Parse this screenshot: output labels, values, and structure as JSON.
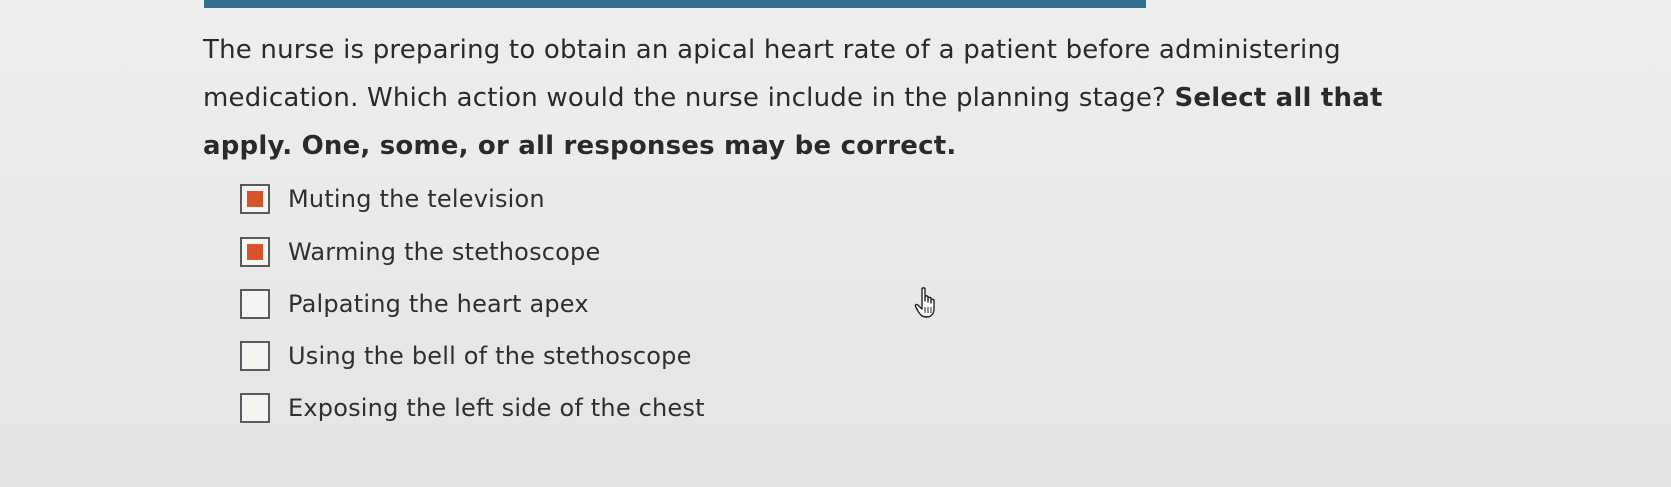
{
  "question": {
    "text": "The nurse is preparing to obtain an apical heart rate of a patient before administering medication. Which action would the nurse include in the planning stage? ",
    "instruction": "Select all that apply. One, some, or all responses may be correct."
  },
  "options": [
    {
      "label": "Muting the television",
      "checked": true
    },
    {
      "label": "Warming the stethoscope",
      "checked": true
    },
    {
      "label": "Palpating the heart apex",
      "checked": false
    },
    {
      "label": "Using the bell of the stethoscope",
      "checked": false
    },
    {
      "label": "Exposing the left side of the chest",
      "checked": false
    }
  ],
  "colors": {
    "accent_bar": "#2f6f8f",
    "checked_fill": "#d9532a"
  },
  "icons": {
    "cursor": "hand-pointer-icon"
  }
}
